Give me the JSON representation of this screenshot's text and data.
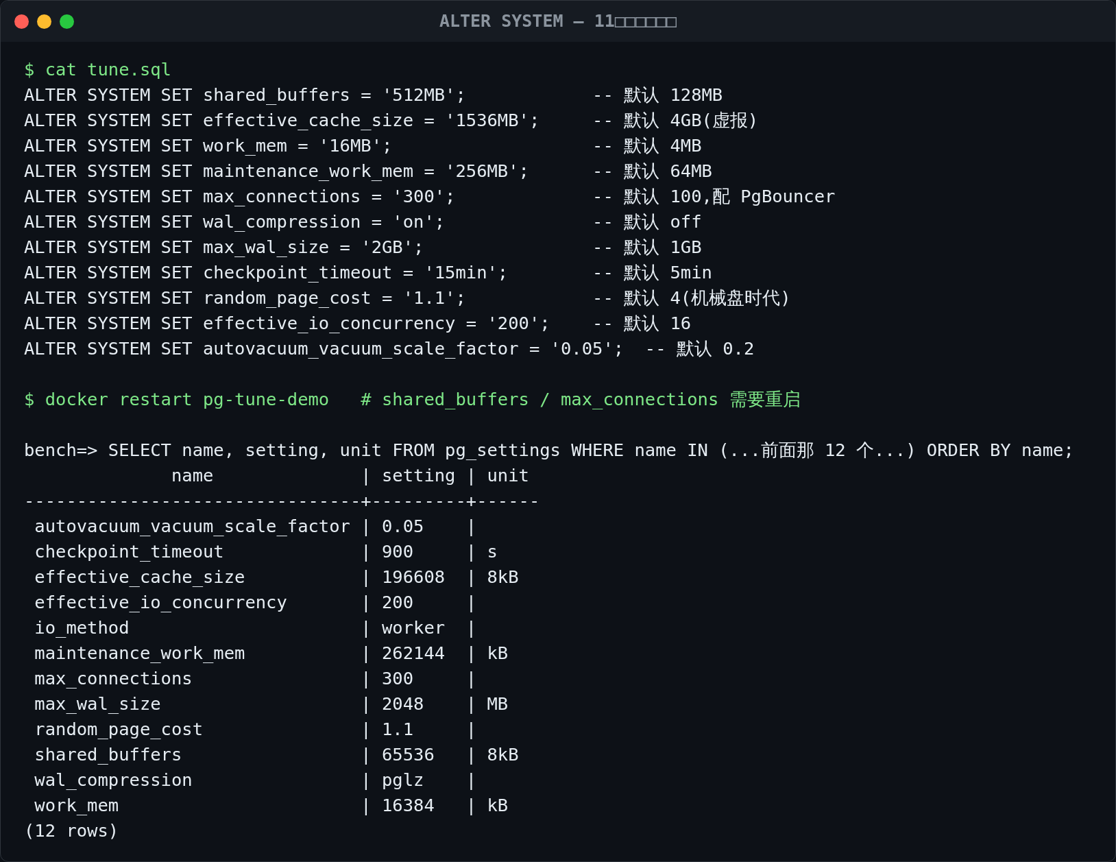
{
  "window": {
    "title": "ALTER SYSTEM — 11□□□□□□"
  },
  "blocks": [
    {
      "lines": [
        {
          "kind": "command",
          "text": "$ cat tune.sql"
        },
        {
          "kind": "output",
          "text": "ALTER SYSTEM SET shared_buffers = '512MB';            -- 默认 128MB"
        },
        {
          "kind": "output",
          "text": "ALTER SYSTEM SET effective_cache_size = '1536MB';     -- 默认 4GB(虚报)"
        },
        {
          "kind": "output",
          "text": "ALTER SYSTEM SET work_mem = '16MB';                   -- 默认 4MB"
        },
        {
          "kind": "output",
          "text": "ALTER SYSTEM SET maintenance_work_mem = '256MB';      -- 默认 64MB"
        },
        {
          "kind": "output",
          "text": "ALTER SYSTEM SET max_connections = '300';             -- 默认 100,配 PgBouncer"
        },
        {
          "kind": "output",
          "text": "ALTER SYSTEM SET wal_compression = 'on';              -- 默认 off"
        },
        {
          "kind": "output",
          "text": "ALTER SYSTEM SET max_wal_size = '2GB';                -- 默认 1GB"
        },
        {
          "kind": "output",
          "text": "ALTER SYSTEM SET checkpoint_timeout = '15min';        -- 默认 5min"
        },
        {
          "kind": "output",
          "text": "ALTER SYSTEM SET random_page_cost = '1.1';            -- 默认 4(机械盘时代)"
        },
        {
          "kind": "output",
          "text": "ALTER SYSTEM SET effective_io_concurrency = '200';    -- 默认 16"
        },
        {
          "kind": "output",
          "text": "ALTER SYSTEM SET autovacuum_vacuum_scale_factor = '0.05';  -- 默认 0.2"
        }
      ]
    },
    {
      "lines": [
        {
          "kind": "command",
          "text": "$ docker restart pg-tune-demo   # shared_buffers / max_connections 需要重启"
        }
      ]
    },
    {
      "lines": [
        {
          "kind": "output",
          "text": "bench=> SELECT name, setting, unit FROM pg_settings WHERE name IN (...前面那 12 个...) ORDER BY name;"
        },
        {
          "kind": "output",
          "text": "              name              | setting | unit"
        },
        {
          "kind": "output",
          "text": "--------------------------------+---------+------"
        },
        {
          "kind": "output",
          "text": " autovacuum_vacuum_scale_factor | 0.05    |"
        },
        {
          "kind": "output",
          "text": " checkpoint_timeout             | 900     | s"
        },
        {
          "kind": "output",
          "text": " effective_cache_size           | 196608  | 8kB"
        },
        {
          "kind": "output",
          "text": " effective_io_concurrency       | 200     |"
        },
        {
          "kind": "output",
          "text": " io_method                      | worker  |"
        },
        {
          "kind": "output",
          "text": " maintenance_work_mem           | 262144  | kB"
        },
        {
          "kind": "output",
          "text": " max_connections                | 300     |"
        },
        {
          "kind": "output",
          "text": " max_wal_size                   | 2048    | MB"
        },
        {
          "kind": "output",
          "text": " random_page_cost               | 1.1     |"
        },
        {
          "kind": "output",
          "text": " shared_buffers                 | 65536   | 8kB"
        },
        {
          "kind": "output",
          "text": " wal_compression                | pglz    |"
        },
        {
          "kind": "output",
          "text": " work_mem                       | 16384   | kB"
        },
        {
          "kind": "output",
          "text": "(12 rows)"
        }
      ]
    }
  ]
}
